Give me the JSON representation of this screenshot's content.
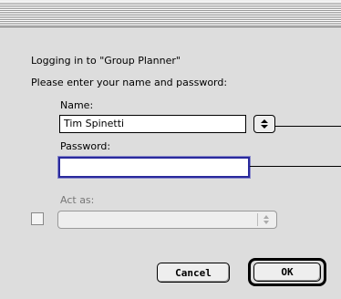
{
  "dialog": {
    "logging_text": "Logging in to \"Group Planner\"",
    "instruction": "Please enter your name and password:",
    "name_label": "Name:",
    "name_value": "Tim Spinetti",
    "password_label": "Password:",
    "password_value": "",
    "act_as_label": "Act as:",
    "act_as_value": "",
    "cancel_label": "Cancel",
    "ok_label": "OK"
  },
  "icons": {
    "name_popup": "up-down-arrows-icon",
    "act_as_popup": "up-down-arrows-icon"
  },
  "colors": {
    "dialog_bg": "#dddddd",
    "focus_border": "#2a2a9c"
  }
}
